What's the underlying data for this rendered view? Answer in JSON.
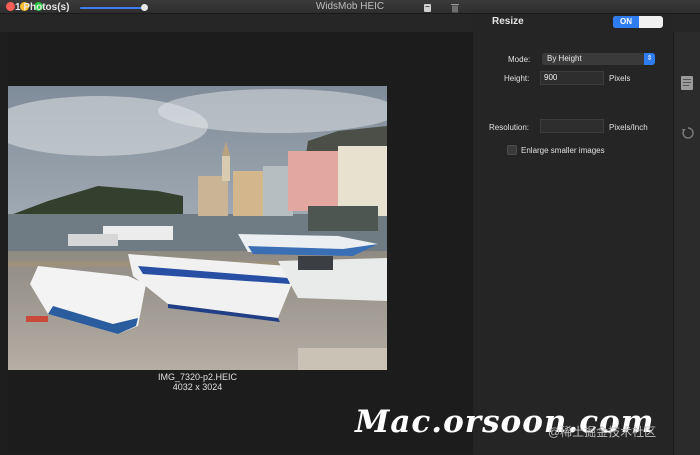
{
  "window": {
    "title": "WidsMob HEIC"
  },
  "toolbar": {
    "photo_count": "1 Photos(s)",
    "slider_value": 1.0,
    "icons": [
      "window-icon",
      "trash-icon"
    ]
  },
  "preview": {
    "filename": "IMG_7320-p2.HEIC",
    "dimensions": "4032 x 3024"
  },
  "resize": {
    "label": "Resize",
    "toggle_label": "ON",
    "mode_label": "Mode:",
    "mode_value": "By Height",
    "height_label": "Height:",
    "height_value": "900",
    "height_unit": "Pixels",
    "resolution_label": "Resolution:",
    "resolution_value": "",
    "resolution_unit": "Pixels/Inch",
    "enlarge_label": "Enlarge smaller images",
    "enlarge_checked": false
  },
  "sidebar_icons": [
    "document-icon",
    "refresh-icon"
  ],
  "watermark": {
    "text": "Mac.orsoon.com",
    "subtext": "@稀土掘金技术社区"
  },
  "colors": {
    "accent": "#2f7cf0",
    "background": "#1e1e1e"
  }
}
